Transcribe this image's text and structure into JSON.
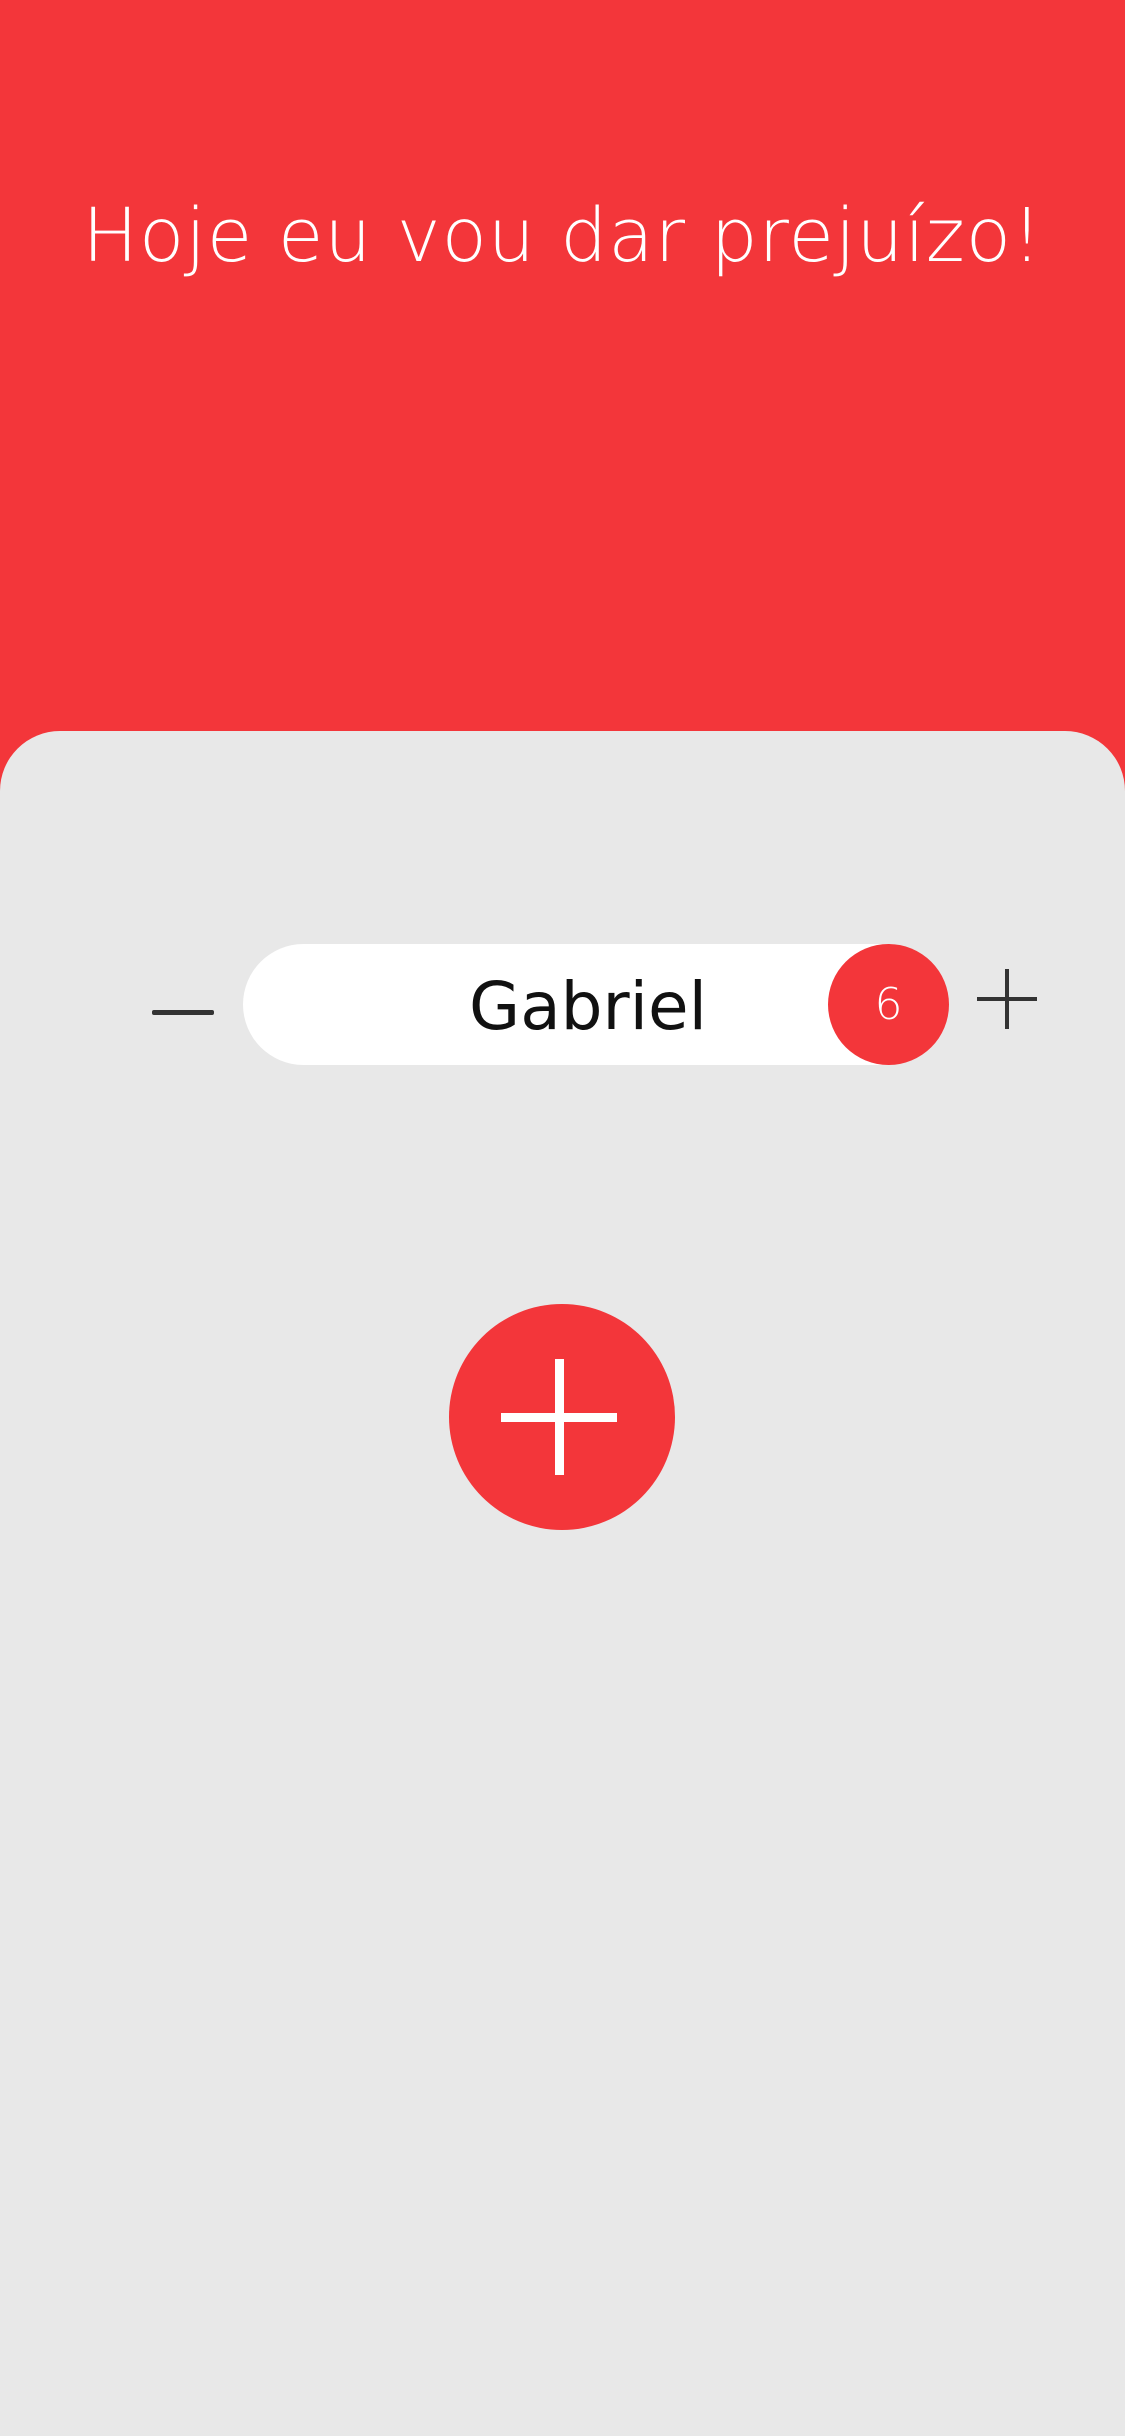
{
  "header": {
    "title": "Hoje eu vou dar prejuízo!"
  },
  "players": [
    {
      "name": "Gabriel",
      "score": "6",
      "decrement_icon": "minus-icon",
      "increment_icon": "plus-icon"
    }
  ],
  "add_player": {
    "icon": "plus-icon"
  },
  "colors": {
    "accent": "#f3363a",
    "panel_background": "#e8e8e8",
    "pill_background": "#ffffff",
    "icon_dark": "#333333"
  }
}
